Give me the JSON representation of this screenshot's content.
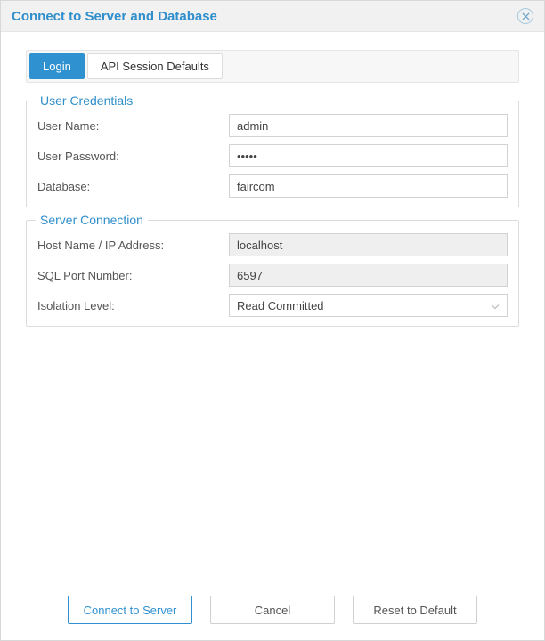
{
  "dialog": {
    "title": "Connect to Server and Database"
  },
  "tabs": {
    "login": "Login",
    "api_defaults": "API Session Defaults"
  },
  "credentials": {
    "legend": "User Credentials",
    "username_label": "User Name:",
    "username_value": "admin",
    "password_label": "User Password:",
    "password_value": "•••••",
    "database_label": "Database:",
    "database_value": "faircom"
  },
  "server": {
    "legend": "Server Connection",
    "host_label": "Host Name / IP Address:",
    "host_value": "localhost",
    "port_label": "SQL Port Number:",
    "port_value": "6597",
    "isolation_label": "Isolation Level:",
    "isolation_value": "Read Committed"
  },
  "buttons": {
    "connect": "Connect to Server",
    "cancel": "Cancel",
    "reset": "Reset to Default"
  }
}
